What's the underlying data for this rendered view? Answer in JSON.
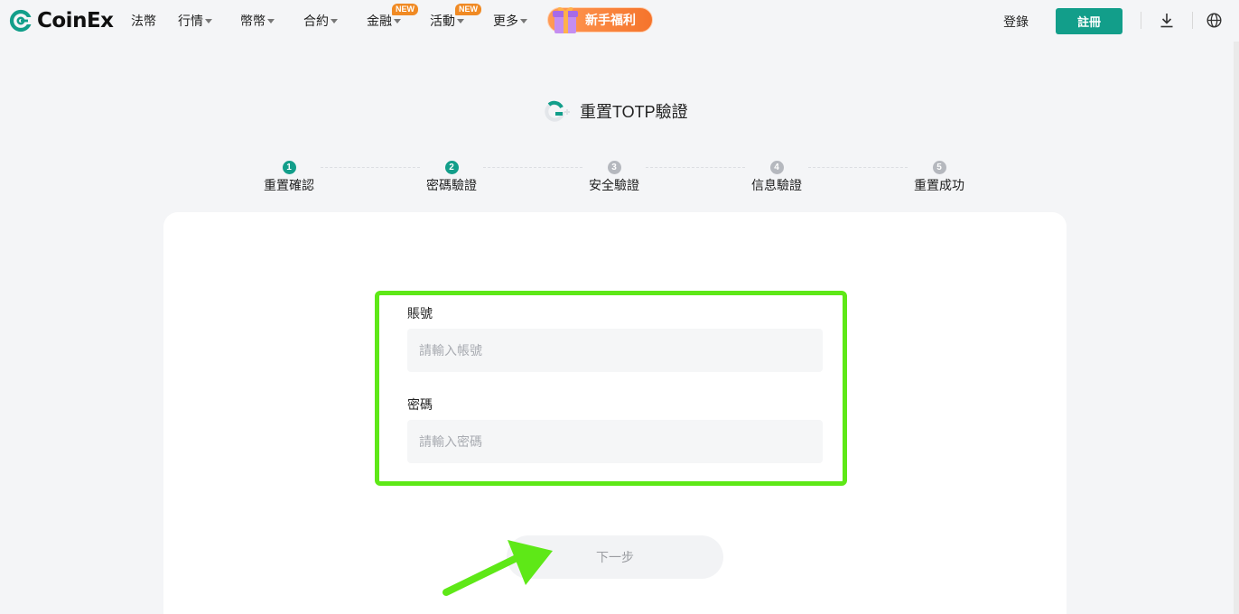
{
  "header": {
    "logo_text": "CoinEx",
    "nav": [
      {
        "label": "法幣",
        "caret": false,
        "badge": ""
      },
      {
        "label": "行情",
        "caret": true,
        "badge": ""
      },
      {
        "label": "幣幣",
        "caret": true,
        "badge": ""
      },
      {
        "label": "合約",
        "caret": true,
        "badge": ""
      },
      {
        "label": "金融",
        "caret": true,
        "badge": "NEW"
      },
      {
        "label": "活動",
        "caret": true,
        "badge": "NEW"
      },
      {
        "label": "更多",
        "caret": true,
        "badge": ""
      }
    ],
    "promo_label": "新手福利",
    "login_label": "登錄",
    "register_label": "註冊",
    "icons": [
      "download-icon",
      "globe-icon"
    ]
  },
  "page": {
    "title": "重置TOTP驗證",
    "title_icon": "google-authenticator-icon"
  },
  "steps": [
    {
      "num": "1",
      "label": "重置確認",
      "active": true
    },
    {
      "num": "2",
      "label": "密碼驗證",
      "active": true
    },
    {
      "num": "3",
      "label": "安全驗證",
      "active": false
    },
    {
      "num": "4",
      "label": "信息驗證",
      "active": false
    },
    {
      "num": "5",
      "label": "重置成功",
      "active": false
    }
  ],
  "form": {
    "account_label": "賬號",
    "account_placeholder": "請輸入帳號",
    "account_value": "",
    "password_label": "密碼",
    "password_placeholder": "請輸入密碼",
    "password_value": "",
    "next_label": "下一步"
  },
  "colors": {
    "brand": "#129e8a",
    "promo": "#f5742c",
    "badge": "#f08a24",
    "highlight": "#5ee817",
    "step_inactive": "#b5b8be"
  }
}
